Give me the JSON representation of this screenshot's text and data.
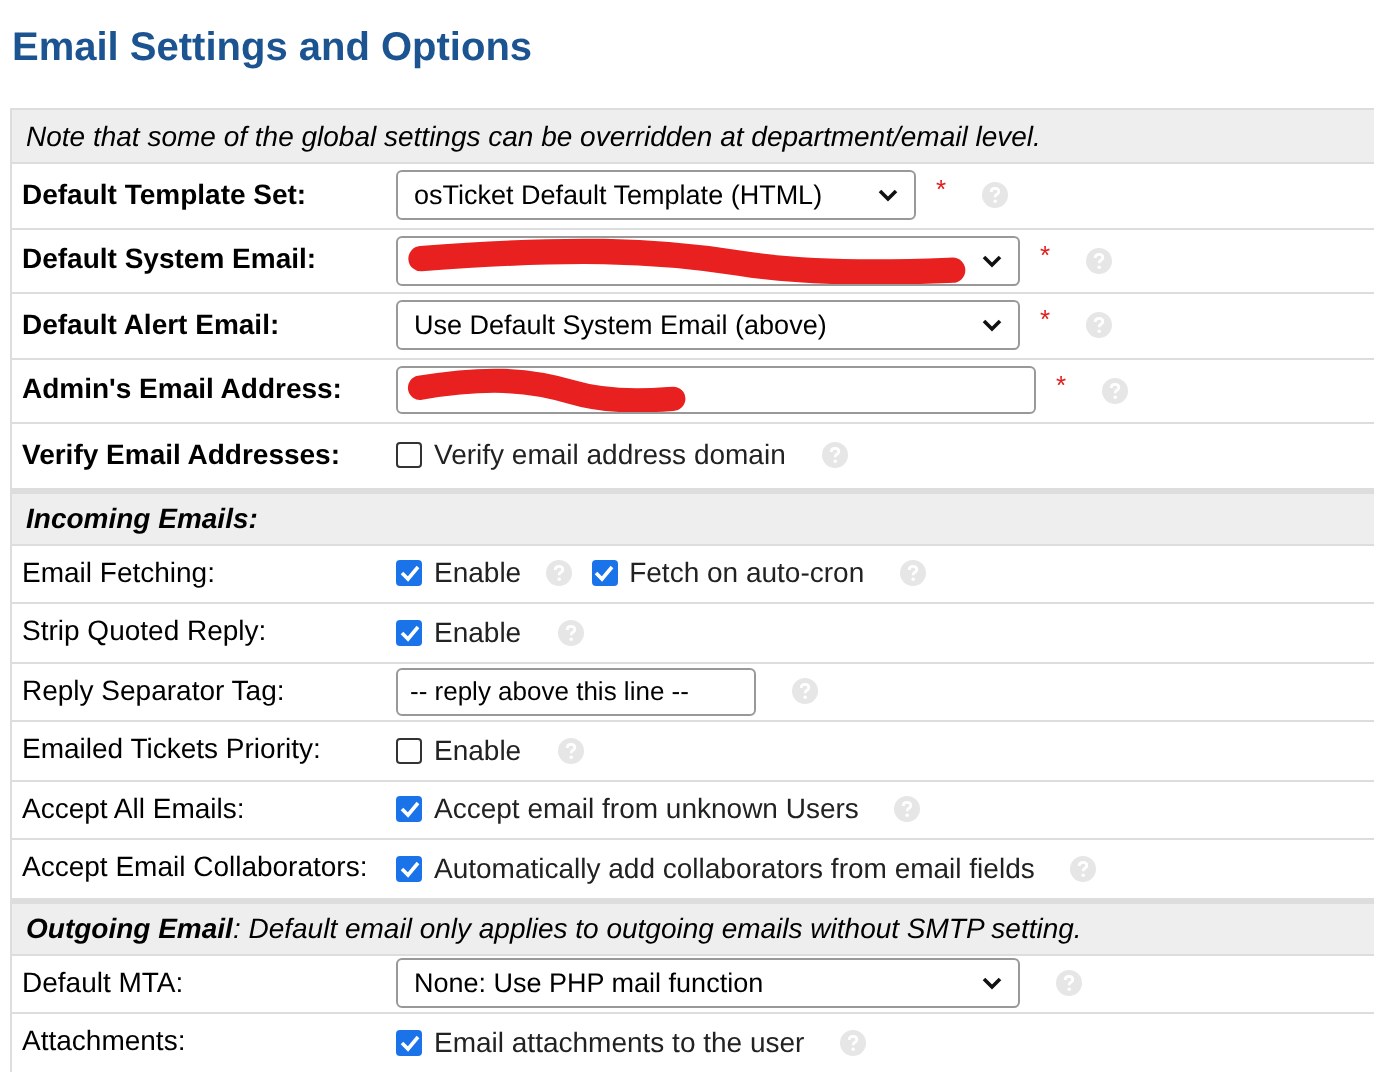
{
  "title": "Email Settings and Options",
  "sections": [
    {
      "kind": "note",
      "heading": "Note that some of the global settings can be overridden at department/email level.",
      "labels_bold": true,
      "rows": [
        {
          "label": "Default Template Set:",
          "required_mark": "*",
          "controls": [
            {
              "kind": "select",
              "value": "osTicket Default Template (HTML)"
            }
          ]
        },
        {
          "label": "Default System Email:",
          "required_mark": "*",
          "controls": [
            {
              "kind": "wide-select",
              "redacted": true
            }
          ]
        },
        {
          "label": "Default Alert Email:",
          "required_mark": "*",
          "controls": [
            {
              "kind": "wide-select",
              "value": "Use Default System Email (above)"
            }
          ]
        },
        {
          "label": "Admin's Email Address:",
          "required_mark": "*",
          "controls": [
            {
              "kind": "input",
              "redacted": true
            }
          ]
        },
        {
          "label": "Verify Email Addresses:",
          "controls": [
            {
              "kind": "checkbox",
              "checked": false,
              "text": "Verify email address domain"
            }
          ]
        }
      ]
    },
    {
      "kind": "header",
      "heading": "Incoming Emails:",
      "labels_bold": false,
      "rows": [
        {
          "label": "Email Fetching:",
          "controls": [
            {
              "kind": "checkbox",
              "checked": true,
              "text": "Enable"
            },
            {
              "kind": "checkbox",
              "checked": true,
              "text": "Fetch on auto-cron"
            }
          ]
        },
        {
          "label": "Strip Quoted Reply:",
          "controls": [
            {
              "kind": "checkbox",
              "checked": true,
              "text": "Enable"
            }
          ]
        },
        {
          "label": "Reply Separator Tag:",
          "controls": [
            {
              "kind": "short-input",
              "value": "-- reply above this line --"
            }
          ]
        },
        {
          "label": "Emailed Tickets Priority:",
          "controls": [
            {
              "kind": "checkbox",
              "checked": false,
              "text": "Enable"
            }
          ]
        },
        {
          "label": "Accept All Emails:",
          "controls": [
            {
              "kind": "checkbox",
              "checked": true,
              "text": "Accept email from unknown Users"
            }
          ]
        },
        {
          "label": "Accept Email Collaborators:",
          "controls": [
            {
              "kind": "checkbox",
              "checked": true,
              "text": "Automatically add collaborators from email fields"
            }
          ]
        }
      ]
    },
    {
      "kind": "note",
      "heading": "**Outgoing Email**: Default email only applies to outgoing emails without SMTP setting.",
      "labels_bold": false,
      "rows": [
        {
          "label": "Default MTA:",
          "controls": [
            {
              "kind": "wide-select",
              "value": "None: Use PHP mail function"
            }
          ]
        },
        {
          "label": "Attachments:",
          "controls": [
            {
              "kind": "checkbox",
              "checked": true,
              "text": "Email attachments to the user"
            }
          ]
        }
      ]
    }
  ]
}
